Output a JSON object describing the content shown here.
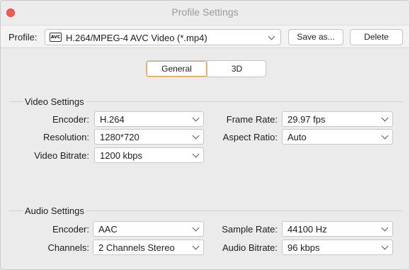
{
  "window": {
    "title": "Profile Settings"
  },
  "toolbar": {
    "profile_label": "Profile:",
    "profile_icon_text": "AVC",
    "profile_value": "H.264/MPEG-4 AVC Video (*.mp4)",
    "save_as_label": "Save as...",
    "delete_label": "Delete"
  },
  "tabs": [
    {
      "label": "General",
      "active": true
    },
    {
      "label": "3D",
      "active": false
    }
  ],
  "video": {
    "section_title": "Video Settings",
    "encoder_label": "Encoder:",
    "encoder_value": "H.264",
    "resolution_label": "Resolution:",
    "resolution_value": "1280*720",
    "bitrate_label": "Video Bitrate:",
    "bitrate_value": "1200 kbps",
    "framerate_label": "Frame Rate:",
    "framerate_value": "29.97 fps",
    "aspect_label": "Aspect Ratio:",
    "aspect_value": "Auto"
  },
  "audio": {
    "section_title": "Audio Settings",
    "encoder_label": "Encoder:",
    "encoder_value": "AAC",
    "channels_label": "Channels:",
    "channels_value": "2 Channels Stereo",
    "samplerate_label": "Sample Rate:",
    "samplerate_value": "44100 Hz",
    "bitrate_label": "Audio Bitrate:",
    "bitrate_value": "96 kbps"
  },
  "colors": {
    "accent": "#f0a12e",
    "close": "#f25a54"
  },
  "icons": [
    "close-icon",
    "avc-icon",
    "chevron-down-icon"
  ]
}
